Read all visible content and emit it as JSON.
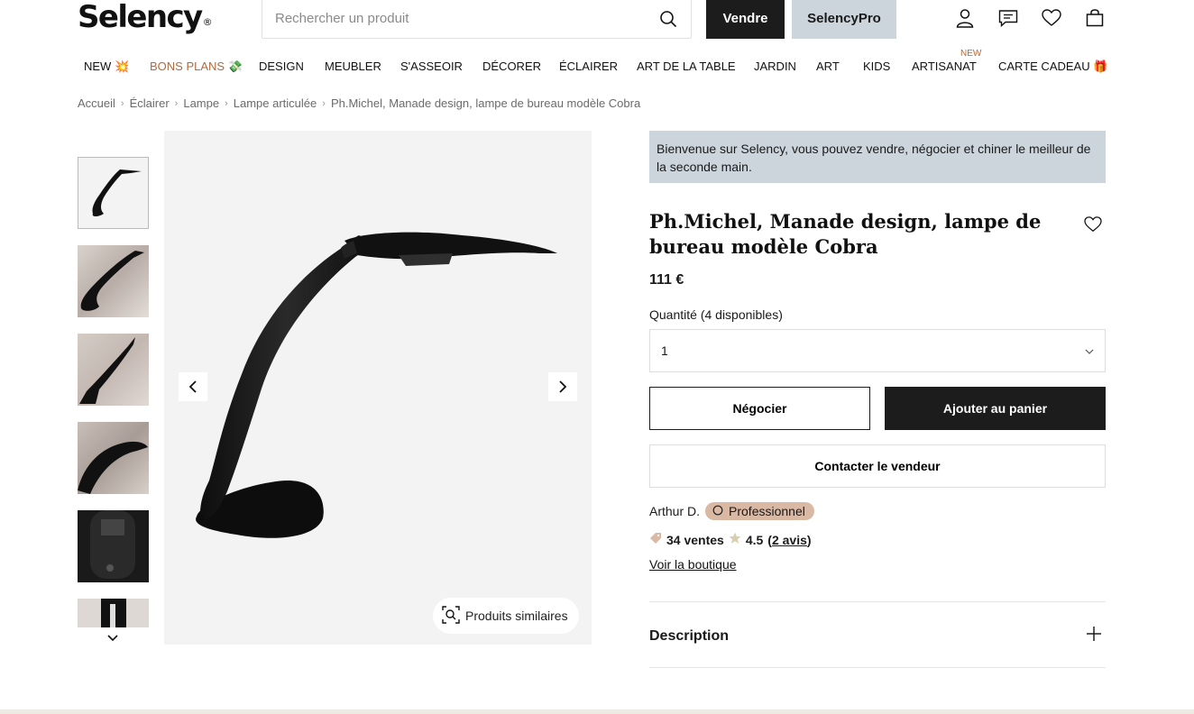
{
  "header": {
    "logo": "Selency",
    "logo_mark": "®",
    "search_placeholder": "Rechercher un produit",
    "sell_label": "Vendre",
    "pro_label": "SelencyPro",
    "icons": [
      "account-icon",
      "messages-icon",
      "favorites-icon",
      "cart-icon"
    ]
  },
  "nav": {
    "items": [
      {
        "label": "NEW",
        "emoji": "💥"
      },
      {
        "label": "BONS PLANS",
        "emoji": "💸"
      },
      {
        "label": "DESIGN"
      },
      {
        "label": "MEUBLER"
      },
      {
        "label": "S'ASSEOIR"
      },
      {
        "label": "DÉCORER"
      },
      {
        "label": "ÉCLAIRER"
      },
      {
        "label": "ART DE LA TABLE"
      },
      {
        "label": "JARDIN"
      },
      {
        "label": "ART"
      },
      {
        "label": "KIDS"
      },
      {
        "label": "ARTISANAT"
      },
      {
        "label": "CARTE CADEAU",
        "emoji": "🎁"
      }
    ],
    "new_tag": "NEW"
  },
  "breadcrumb": [
    "Accueil",
    "Éclairer",
    "Lampe",
    "Lampe articulée",
    "Ph.Michel, Manade design, lampe de bureau modèle Cobra"
  ],
  "gallery": {
    "similar_label": "Produits similaires",
    "thumb_count": 6
  },
  "product": {
    "banner": "Bienvenue sur Selency, vous pouvez vendre, négocier et chiner le meilleur de la seconde main.",
    "title": "Ph.Michel, Manade design, lampe de bureau modèle Cobra",
    "price": "111 €",
    "quantity_label": "Quantité (4 disponibles)",
    "quantity_value": "1",
    "negotiate_label": "Négocier",
    "add_to_cart_label": "Ajouter au panier",
    "contact_label": "Contacter le vendeur",
    "seller_name": "Arthur D.",
    "seller_badge": "Professionnel",
    "sales": "34 ventes",
    "rating": "4.5",
    "reviews": "2 avis",
    "shop_link": "Voir la boutique",
    "description_label": "Description"
  },
  "colors": {
    "accent_dark": "#1c1c1c",
    "pro_blue": "#ccd5dc",
    "badge_tan": "#d9b8a4",
    "nav_orange": "#b06a3d"
  }
}
